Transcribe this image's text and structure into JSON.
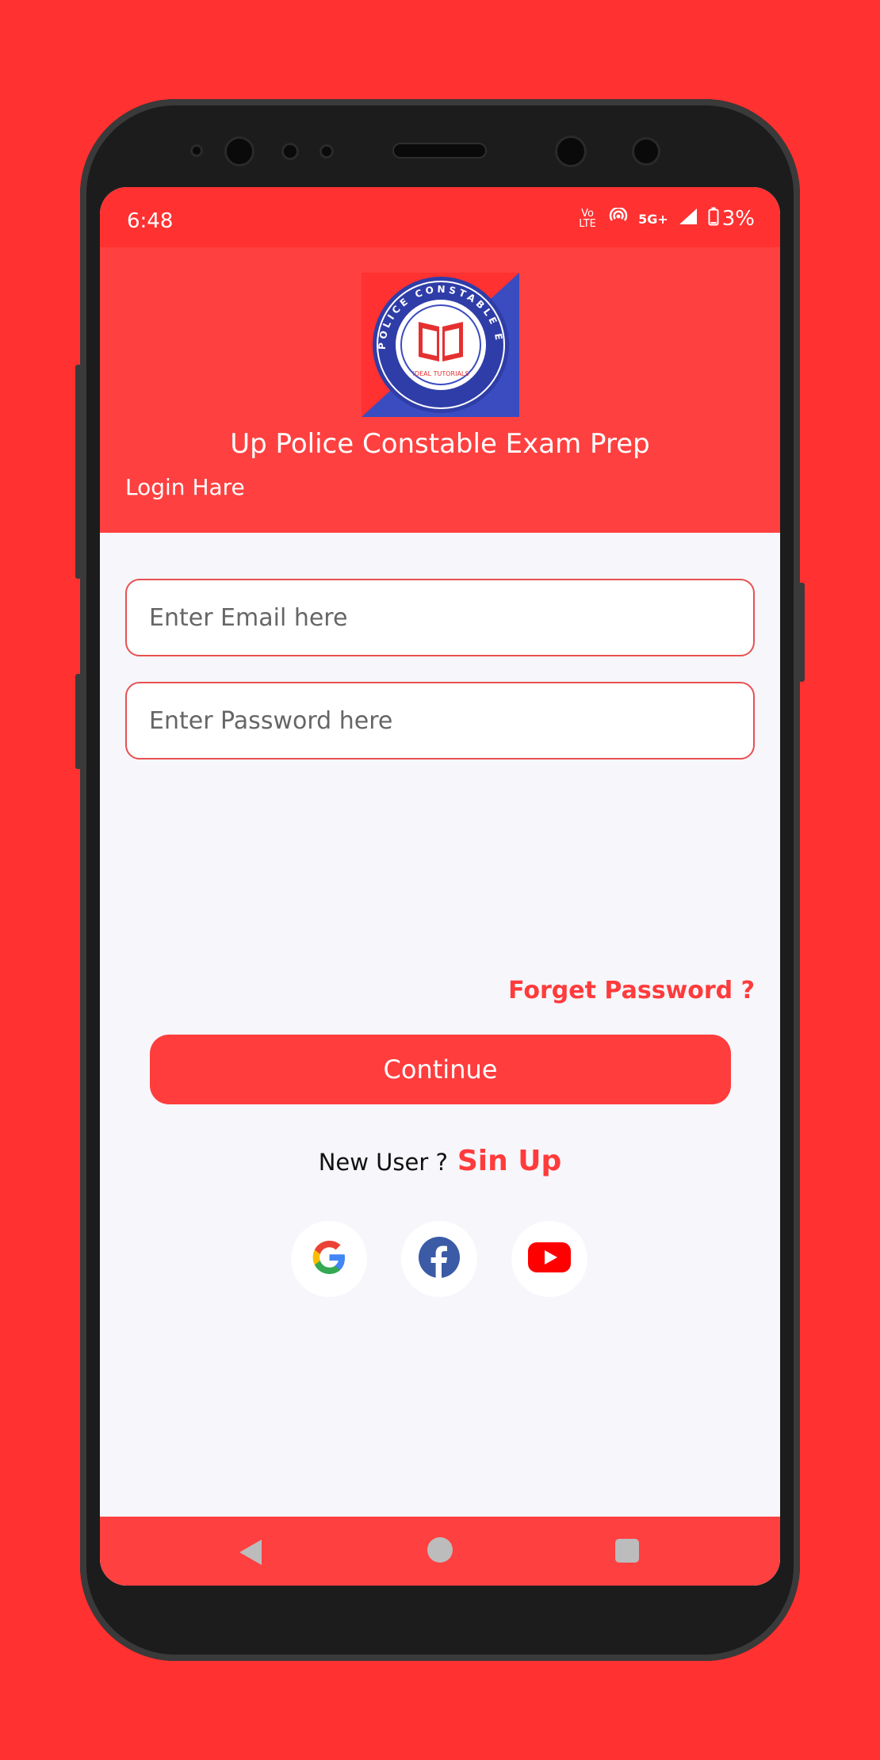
{
  "status_bar": {
    "time": "6:48",
    "network_label": "5G+",
    "volte_label": "Vo LTE",
    "battery": "3%"
  },
  "header": {
    "app_title": "Up Police Constable Exam Prep",
    "login_label": "Login Hare",
    "logo_text": "UP POLICE CONSTABLE EXAM",
    "logo_subtext": "IDEAL TUTORIALS"
  },
  "form": {
    "email_placeholder": "Enter Email here",
    "password_placeholder": "Enter Password here",
    "forget_password": "Forget Password ?",
    "continue_label": "Continue",
    "new_user_text": "New User ?",
    "signup_label": "Sin Up"
  },
  "social": [
    {
      "name": "google",
      "icon": "google-icon"
    },
    {
      "name": "facebook",
      "icon": "facebook-icon"
    },
    {
      "name": "youtube",
      "icon": "youtube-icon"
    }
  ],
  "colors": {
    "background": "#ff3131",
    "accent": "#ff4040",
    "field_border": "#e85050",
    "card": "#f6f6fb"
  }
}
